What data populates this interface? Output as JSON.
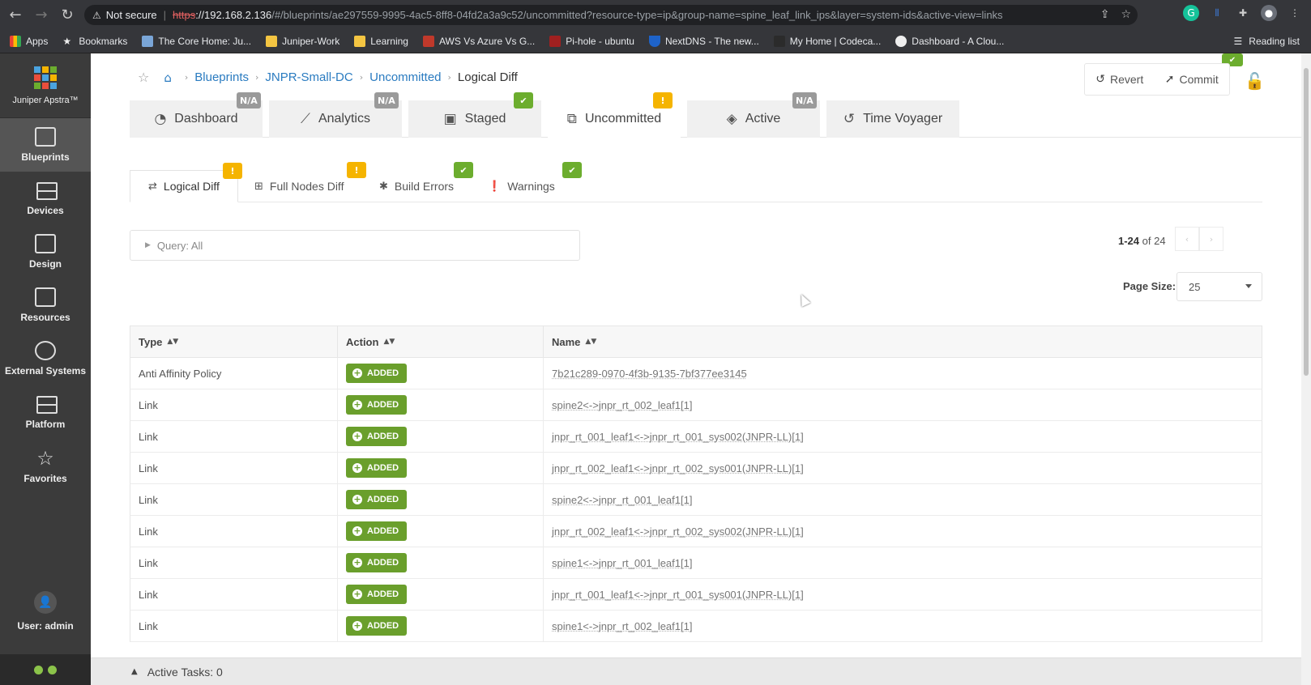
{
  "browser": {
    "not_secure": "Not secure",
    "url_scheme": "https",
    "url_host": "://192.168.2.136",
    "url_rest": "/#/blueprints/ae297559-9995-4ac5-8ff8-04fd2a3a9c52/uncommitted?resource-type=ip&group-name=spine_leaf_link_ips&layer=system-ids&active-view=links",
    "bookmarks": [
      "Apps",
      "Bookmarks",
      "The Core Home: Ju...",
      "Juniper-Work",
      "Learning",
      "AWS Vs Azure Vs G...",
      "Pi-hole - ubuntu",
      "NextDNS - The new...",
      "My Home | Codeca...",
      "Dashboard - A Clou..."
    ],
    "reading_list": "Reading list"
  },
  "sidebar": {
    "logo_text": "Juniper Apstra™",
    "items": [
      {
        "label": "Blueprints",
        "icon": "blueprints-icon"
      },
      {
        "label": "Devices",
        "icon": "devices-icon"
      },
      {
        "label": "Design",
        "icon": "design-icon"
      },
      {
        "label": "Resources",
        "icon": "resources-icon"
      },
      {
        "label": "External Systems",
        "icon": "external-systems-icon"
      },
      {
        "label": "Platform",
        "icon": "platform-icon"
      },
      {
        "label": "Favorites",
        "icon": "star-icon"
      }
    ],
    "user": "User: admin"
  },
  "breadcrumb": [
    "Blueprints",
    "JNPR-Small-DC",
    "Uncommitted",
    "Logical Diff"
  ],
  "actions": {
    "revert": "Revert",
    "commit": "Commit"
  },
  "tabs": [
    {
      "label": "Dashboard",
      "badge": "N/A"
    },
    {
      "label": "Analytics",
      "badge": "N/A"
    },
    {
      "label": "Staged",
      "badge": "✔"
    },
    {
      "label": "Uncommitted",
      "badge": "!"
    },
    {
      "label": "Active",
      "badge": "N/A"
    },
    {
      "label": "Time Voyager",
      "badge": ""
    }
  ],
  "subtabs": [
    {
      "label": "Logical Diff",
      "badge": "!"
    },
    {
      "label": "Full Nodes Diff",
      "badge": "!"
    },
    {
      "label": "Build Errors",
      "badge": "✔"
    },
    {
      "label": "Warnings",
      "badge": "✔"
    }
  ],
  "query": "Query: All",
  "pager": {
    "range": "1-24",
    "of": "of 24"
  },
  "page_size": {
    "label": "Page Size:",
    "value": "25"
  },
  "table": {
    "headers": [
      "Type",
      "Action",
      "Name"
    ],
    "rows": [
      {
        "type": "Anti Affinity Policy",
        "action": "ADDED",
        "name": "7b21c289-0970-4f3b-9135-7bf377ee3145"
      },
      {
        "type": "Link",
        "action": "ADDED",
        "name": "spine2<->jnpr_rt_002_leaf1[1]"
      },
      {
        "type": "Link",
        "action": "ADDED",
        "name": "jnpr_rt_001_leaf1<->jnpr_rt_001_sys002(JNPR-LL)[1]"
      },
      {
        "type": "Link",
        "action": "ADDED",
        "name": "jnpr_rt_002_leaf1<->jnpr_rt_002_sys001(JNPR-LL)[1]"
      },
      {
        "type": "Link",
        "action": "ADDED",
        "name": "spine2<->jnpr_rt_001_leaf1[1]"
      },
      {
        "type": "Link",
        "action": "ADDED",
        "name": "jnpr_rt_002_leaf1<->jnpr_rt_002_sys002(JNPR-LL)[1]"
      },
      {
        "type": "Link",
        "action": "ADDED",
        "name": "spine1<->jnpr_rt_001_leaf1[1]"
      },
      {
        "type": "Link",
        "action": "ADDED",
        "name": "jnpr_rt_001_leaf1<->jnpr_rt_001_sys001(JNPR-LL)[1]"
      },
      {
        "type": "Link",
        "action": "ADDED",
        "name": "spine1<->jnpr_rt_002_leaf1[1]"
      }
    ]
  },
  "taskbar": "Active Tasks: 0",
  "colors": {
    "accent": "#2a7bc0",
    "ok": "#6cad2e",
    "warn": "#f5b400",
    "sidebar": "#3b3b3b"
  }
}
